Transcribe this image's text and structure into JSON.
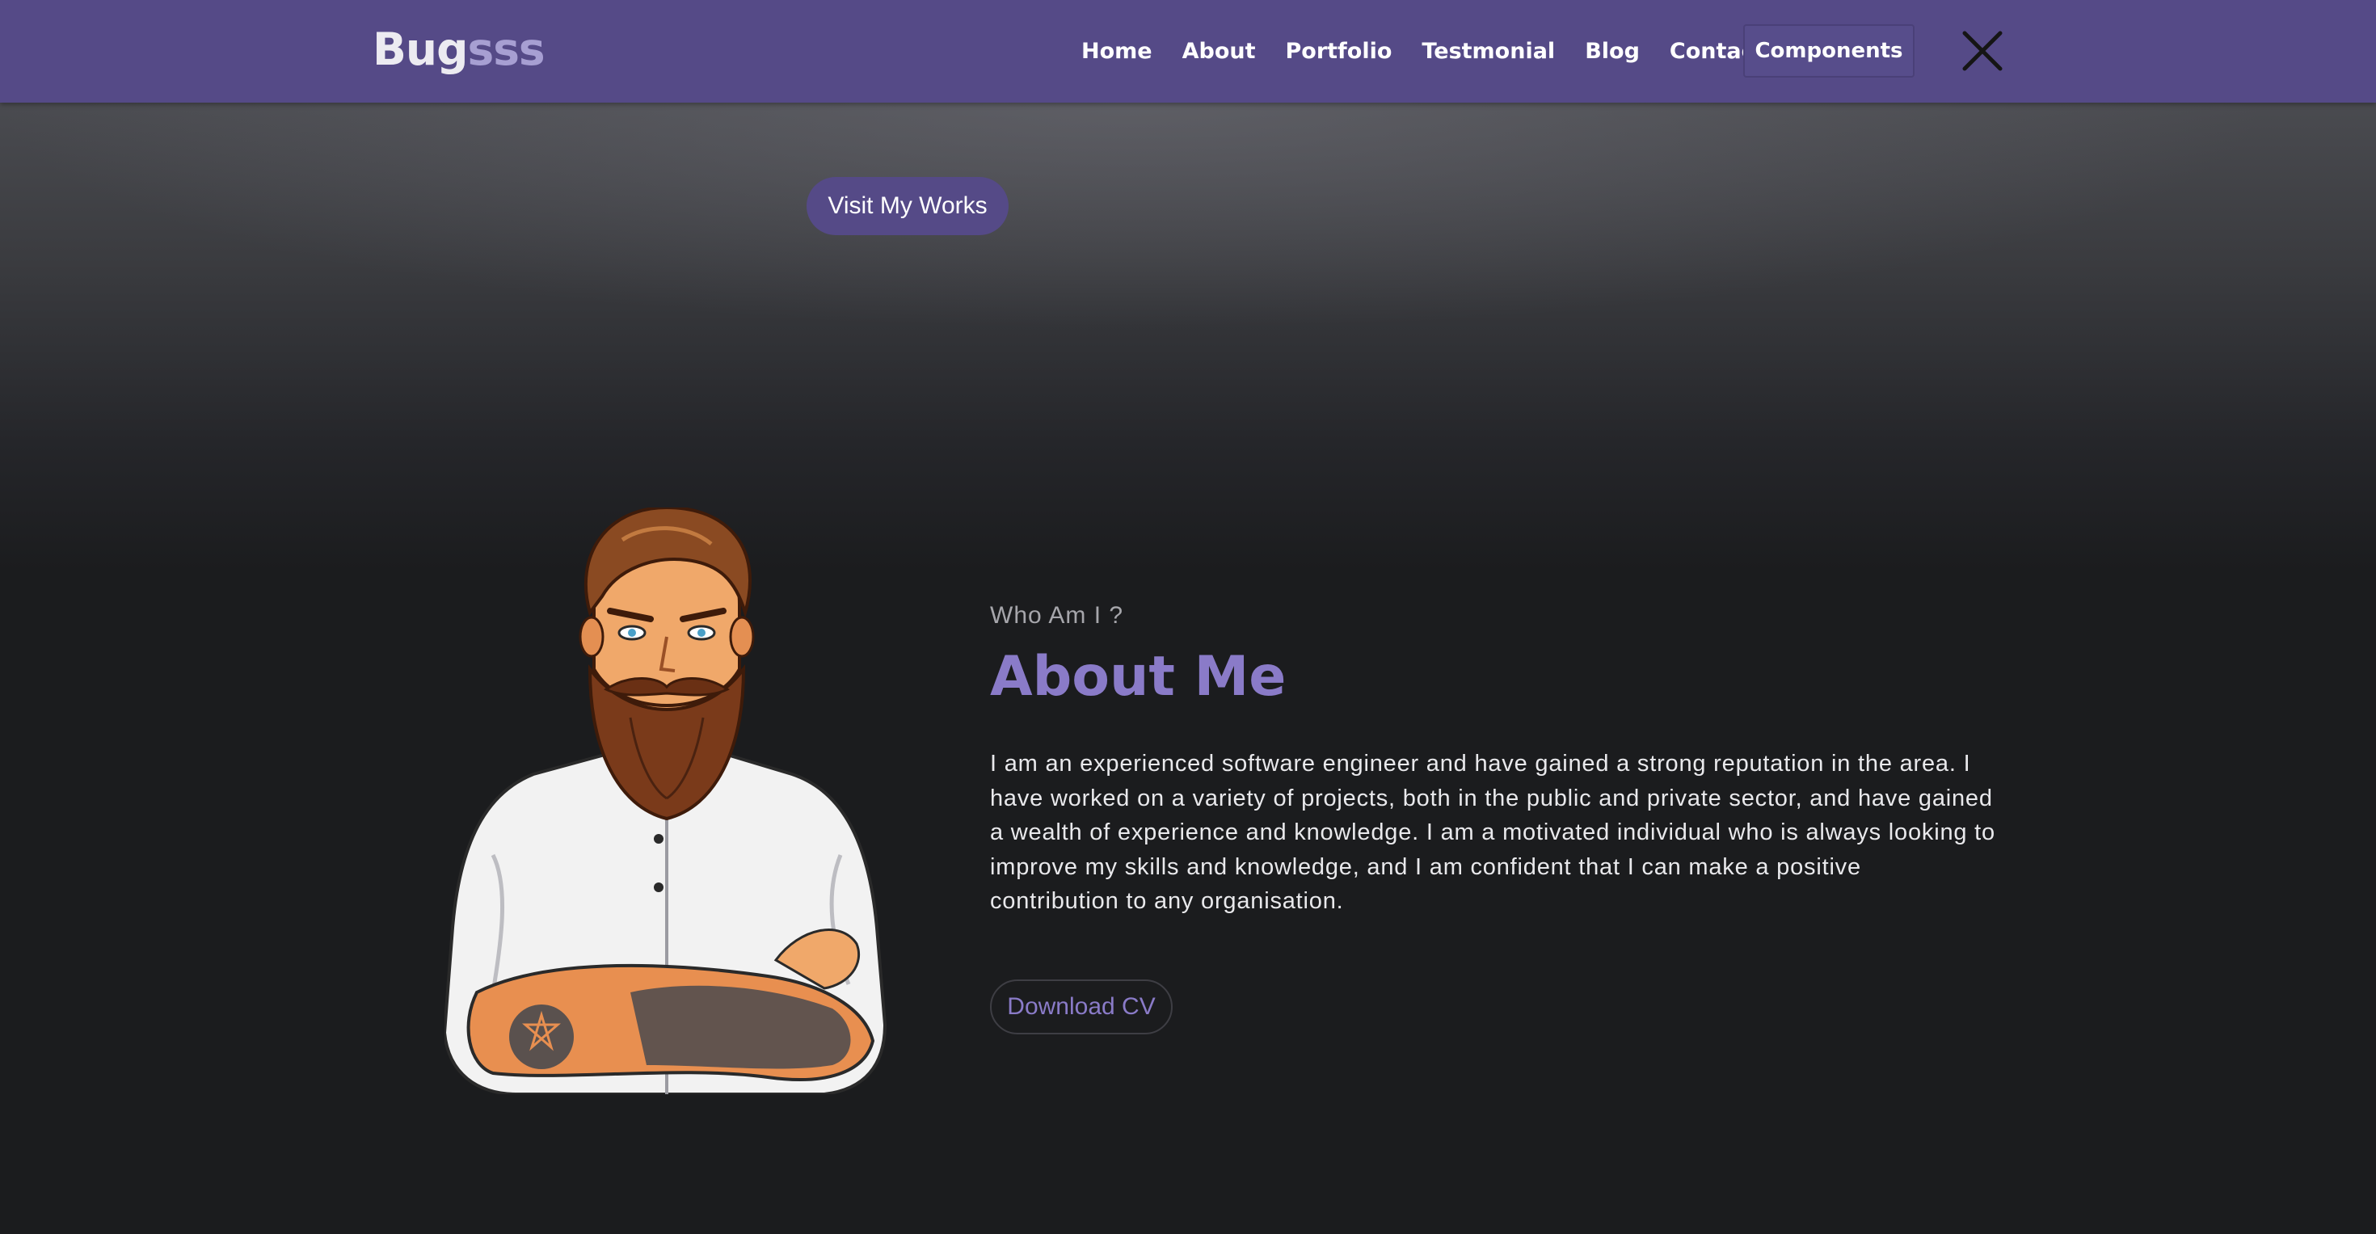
{
  "header": {
    "brand_primary": "Bug",
    "brand_secondary": "sss",
    "nav": [
      {
        "label": "Home"
      },
      {
        "label": "About"
      },
      {
        "label": "Portfolio"
      },
      {
        "label": "Testmonial"
      },
      {
        "label": "Blog"
      },
      {
        "label": "Contact"
      }
    ],
    "components_label": "Components",
    "close_icon": "close-icon"
  },
  "hero": {
    "visit_label": "Visit My Works"
  },
  "about": {
    "subtitle": "Who Am I ?",
    "title": "About Me",
    "description": "I am an experienced software engineer and have gained a strong reputation in the area. I have worked on a variety of projects, both in the public and private sector, and have gained a wealth of experience and knowledge. I am a motivated individual who is always looking to improve my skills and knowledge, and I am confident that I can make a positive contribution to any organisation.",
    "download_label": "Download CV",
    "portrait_icon": "bearded-man-portrait"
  },
  "colors": {
    "brand_purple": "#554a87",
    "accent_lavender": "#8a7bc8",
    "background_dark": "#1b1c1e"
  }
}
